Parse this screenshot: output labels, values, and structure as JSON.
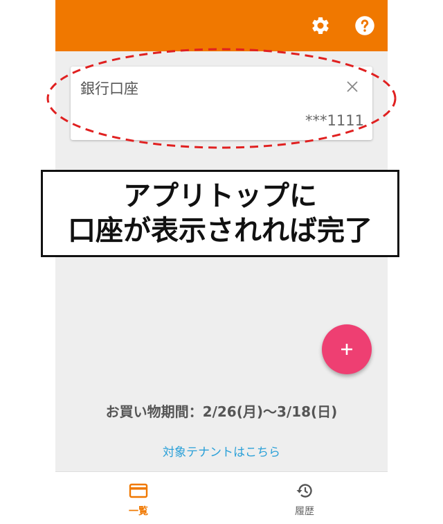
{
  "colors": {
    "primary": "#f07800",
    "fab": "#ee3f72",
    "link": "#2aa0d8",
    "annotation": "#e02020"
  },
  "appbar": {
    "icons": [
      "gear-icon",
      "help-icon"
    ]
  },
  "card": {
    "title": "銀行口座",
    "masked_number": "***1111",
    "close_icon": "close-icon"
  },
  "notice": {
    "line1": "アプリトップに",
    "line2": "口座が表示されれば完了"
  },
  "fab": {
    "label": "+"
  },
  "period": {
    "text": "お買い物期間：2/26(月)〜3/18(日)"
  },
  "tenant_link": {
    "text": "対象テナントはこちら"
  },
  "bottom_nav": {
    "items": [
      {
        "label": "一覧",
        "icon": "card-icon",
        "active": true
      },
      {
        "label": "履歴",
        "icon": "history-icon",
        "active": false
      }
    ]
  }
}
